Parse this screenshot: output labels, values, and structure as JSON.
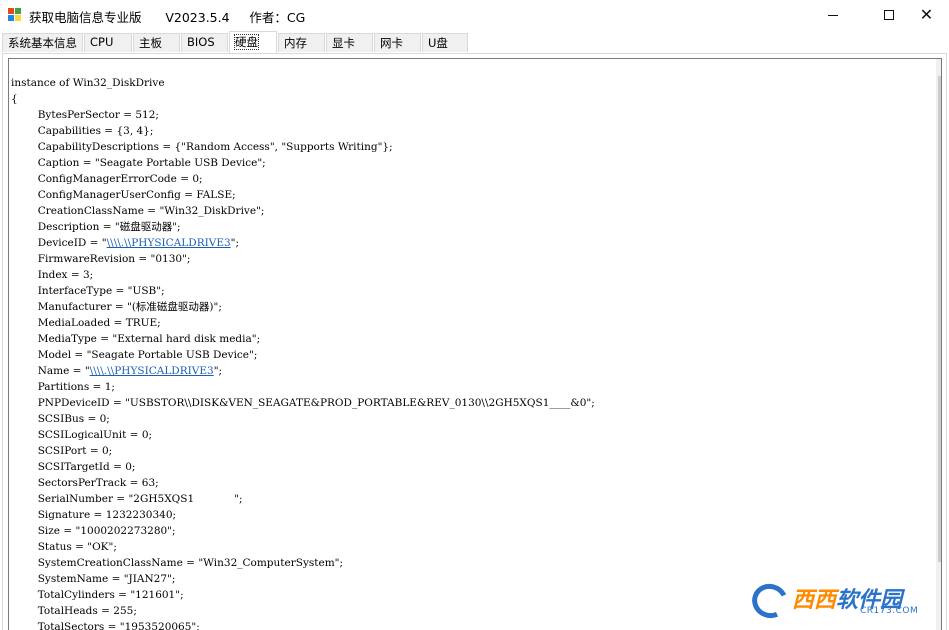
{
  "window": {
    "title": "获取电脑信息专业版      V2023.5.4     作者：CG",
    "app_icon": "windows-app-icon"
  },
  "tabs": [
    {
      "label": "系统基本信息",
      "active": false
    },
    {
      "label": "CPU",
      "active": false
    },
    {
      "label": "主板",
      "active": false
    },
    {
      "label": "BIOS",
      "active": false
    },
    {
      "label": "硬盘",
      "active": true
    },
    {
      "label": "内存",
      "active": false
    },
    {
      "label": "显卡",
      "active": false
    },
    {
      "label": "网卡",
      "active": false
    },
    {
      "label": "U盘",
      "active": false
    }
  ],
  "content": {
    "header": "instance of Win32_DiskDrive",
    "open_brace": "{",
    "lines": [
      {
        "key": "BytesPerSector",
        "value": "512;"
      },
      {
        "key": "Capabilities",
        "value": "{3, 4};"
      },
      {
        "key": "CapabilityDescriptions",
        "value": "{\"Random Access\", \"Supports Writing\"};"
      },
      {
        "key": "Caption",
        "value": "\"Seagate Portable USB Device\";"
      },
      {
        "key": "ConfigManagerErrorCode",
        "value": "0;"
      },
      {
        "key": "ConfigManagerUserConfig",
        "value": "FALSE;"
      },
      {
        "key": "CreationClassName",
        "value": "\"Win32_DiskDrive\";"
      },
      {
        "key": "Description",
        "value": "\"磁盘驱动器\";"
      },
      {
        "key": "DeviceID",
        "pre": "\"",
        "link": "\\\\\\\\.\\\\PHYSICALDRIVE3",
        "post": "\";"
      },
      {
        "key": "FirmwareRevision",
        "value": "\"0130\";"
      },
      {
        "key": "Index",
        "value": "3;"
      },
      {
        "key": "InterfaceType",
        "value": "\"USB\";"
      },
      {
        "key": "Manufacturer",
        "value": "\"(标准磁盘驱动器)\";"
      },
      {
        "key": "MediaLoaded",
        "value": "TRUE;"
      },
      {
        "key": "MediaType",
        "value": "\"External hard disk media\";"
      },
      {
        "key": "Model",
        "value": "\"Seagate Portable USB Device\";"
      },
      {
        "key": "Name",
        "pre": "\"",
        "link": "\\\\\\\\.\\\\PHYSICALDRIVE3",
        "post": "\";"
      },
      {
        "key": "Partitions",
        "value": "1;"
      },
      {
        "key": "PNPDeviceID",
        "value": "\"USBSTOR\\\\DISK&VEN_SEAGATE&PROD_PORTABLE&REV_0130\\\\2GH5XQS1____&0\";"
      },
      {
        "key": "SCSIBus",
        "value": "0;"
      },
      {
        "key": "SCSILogicalUnit",
        "value": "0;"
      },
      {
        "key": "SCSIPort",
        "value": "0;"
      },
      {
        "key": "SCSITargetId",
        "value": "0;"
      },
      {
        "key": "SectorsPerTrack",
        "value": "63;"
      },
      {
        "key": "SerialNumber",
        "value": "\"2GH5XQS1            \";"
      },
      {
        "key": "Signature",
        "value": "1232230340;"
      },
      {
        "key": "Size",
        "value": "\"1000202273280\";"
      },
      {
        "key": "Status",
        "value": "\"OK\";"
      },
      {
        "key": "SystemCreationClassName",
        "value": "\"Win32_ComputerSystem\";"
      },
      {
        "key": "SystemName",
        "value": "\"JIAN27\";"
      },
      {
        "key": "TotalCylinders",
        "value": "\"121601\";"
      },
      {
        "key": "TotalHeads",
        "value": "255;"
      },
      {
        "key": "TotalSectors",
        "value": "\"1953520065\";"
      }
    ]
  },
  "watermark": {
    "main_a": "西西",
    "main_b": "软件园",
    "sub": "CR173.COM"
  }
}
